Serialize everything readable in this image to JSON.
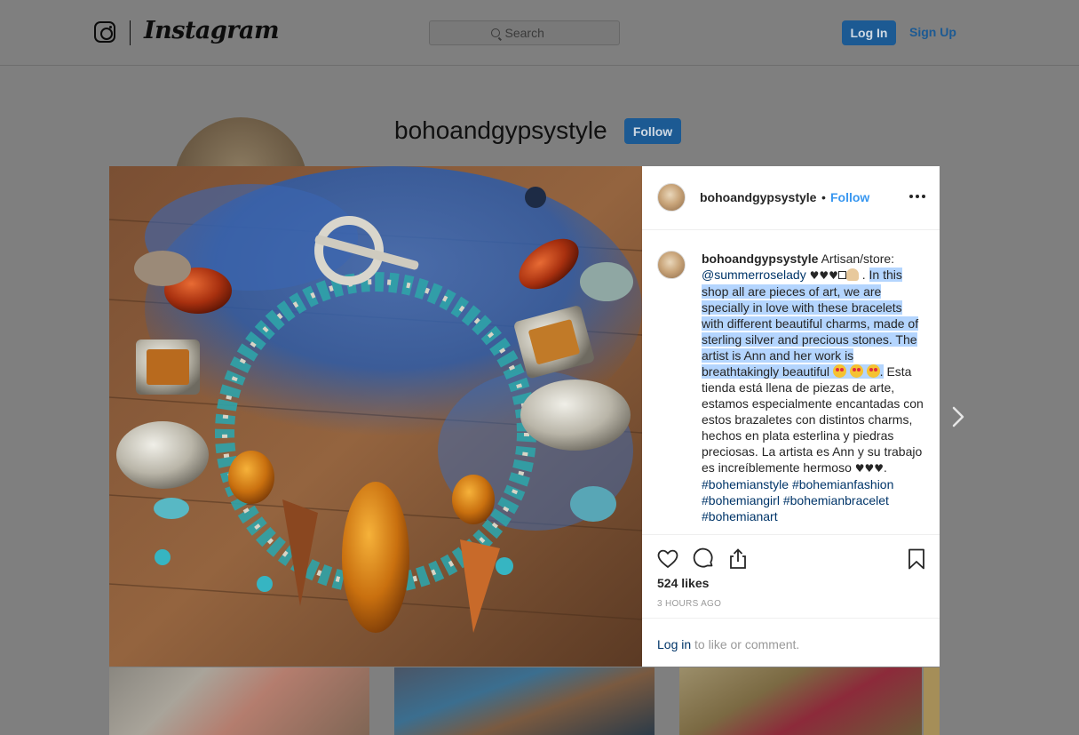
{
  "nav": {
    "brand": "Instagram",
    "search_placeholder": "Search",
    "login_label": "Log In",
    "signup_label": "Sign Up"
  },
  "profile": {
    "username": "bohoandgypsystyle",
    "follow_label": "Follow"
  },
  "post": {
    "username": "bohoandgypsystyle",
    "separator": "•",
    "follow_label": "Follow",
    "caption": {
      "username": "bohoandgypsystyle",
      "intro": "Artisan/store:",
      "mention": "@summerroselady",
      "hearts_1": "♥♥♥",
      "highlighted": "In this shop all are pieces of art, we are specially in love with these bracelets with different beautiful charms, made of sterling silver and precious stones. The artist is Ann and her work is breathtakingly beautiful",
      "spanish": "Esta tienda está llena de piezas de arte, estamos especialmente encantadas con estos brazaletes con distintos charms, hechos en plata esterlina y piedras preciosas. La artista es Ann y su trabajo es increíblemente hermoso",
      "hearts_2": "♥♥♥.",
      "hashtags": [
        "#bohemianstyle",
        "#bohemianfashion",
        "#bohemiangirl",
        "#bohemianbracelet",
        "#bohemianart"
      ]
    },
    "likes": "524 likes",
    "timestamp": "3 HOURS AGO",
    "login_prompt_link": "Log in",
    "login_prompt_text": " to like or comment."
  },
  "icons": {
    "instagram": "instagram-glyph-icon",
    "search": "search-icon",
    "more": "more-options-icon",
    "like": "heart-icon",
    "comment": "comment-bubble-icon",
    "share": "share-icon",
    "save": "bookmark-icon",
    "next": "chevron-right-icon"
  },
  "colors": {
    "link_blue": "#3897f0",
    "dark_link": "#003569",
    "selection": "#b4d5fe"
  }
}
